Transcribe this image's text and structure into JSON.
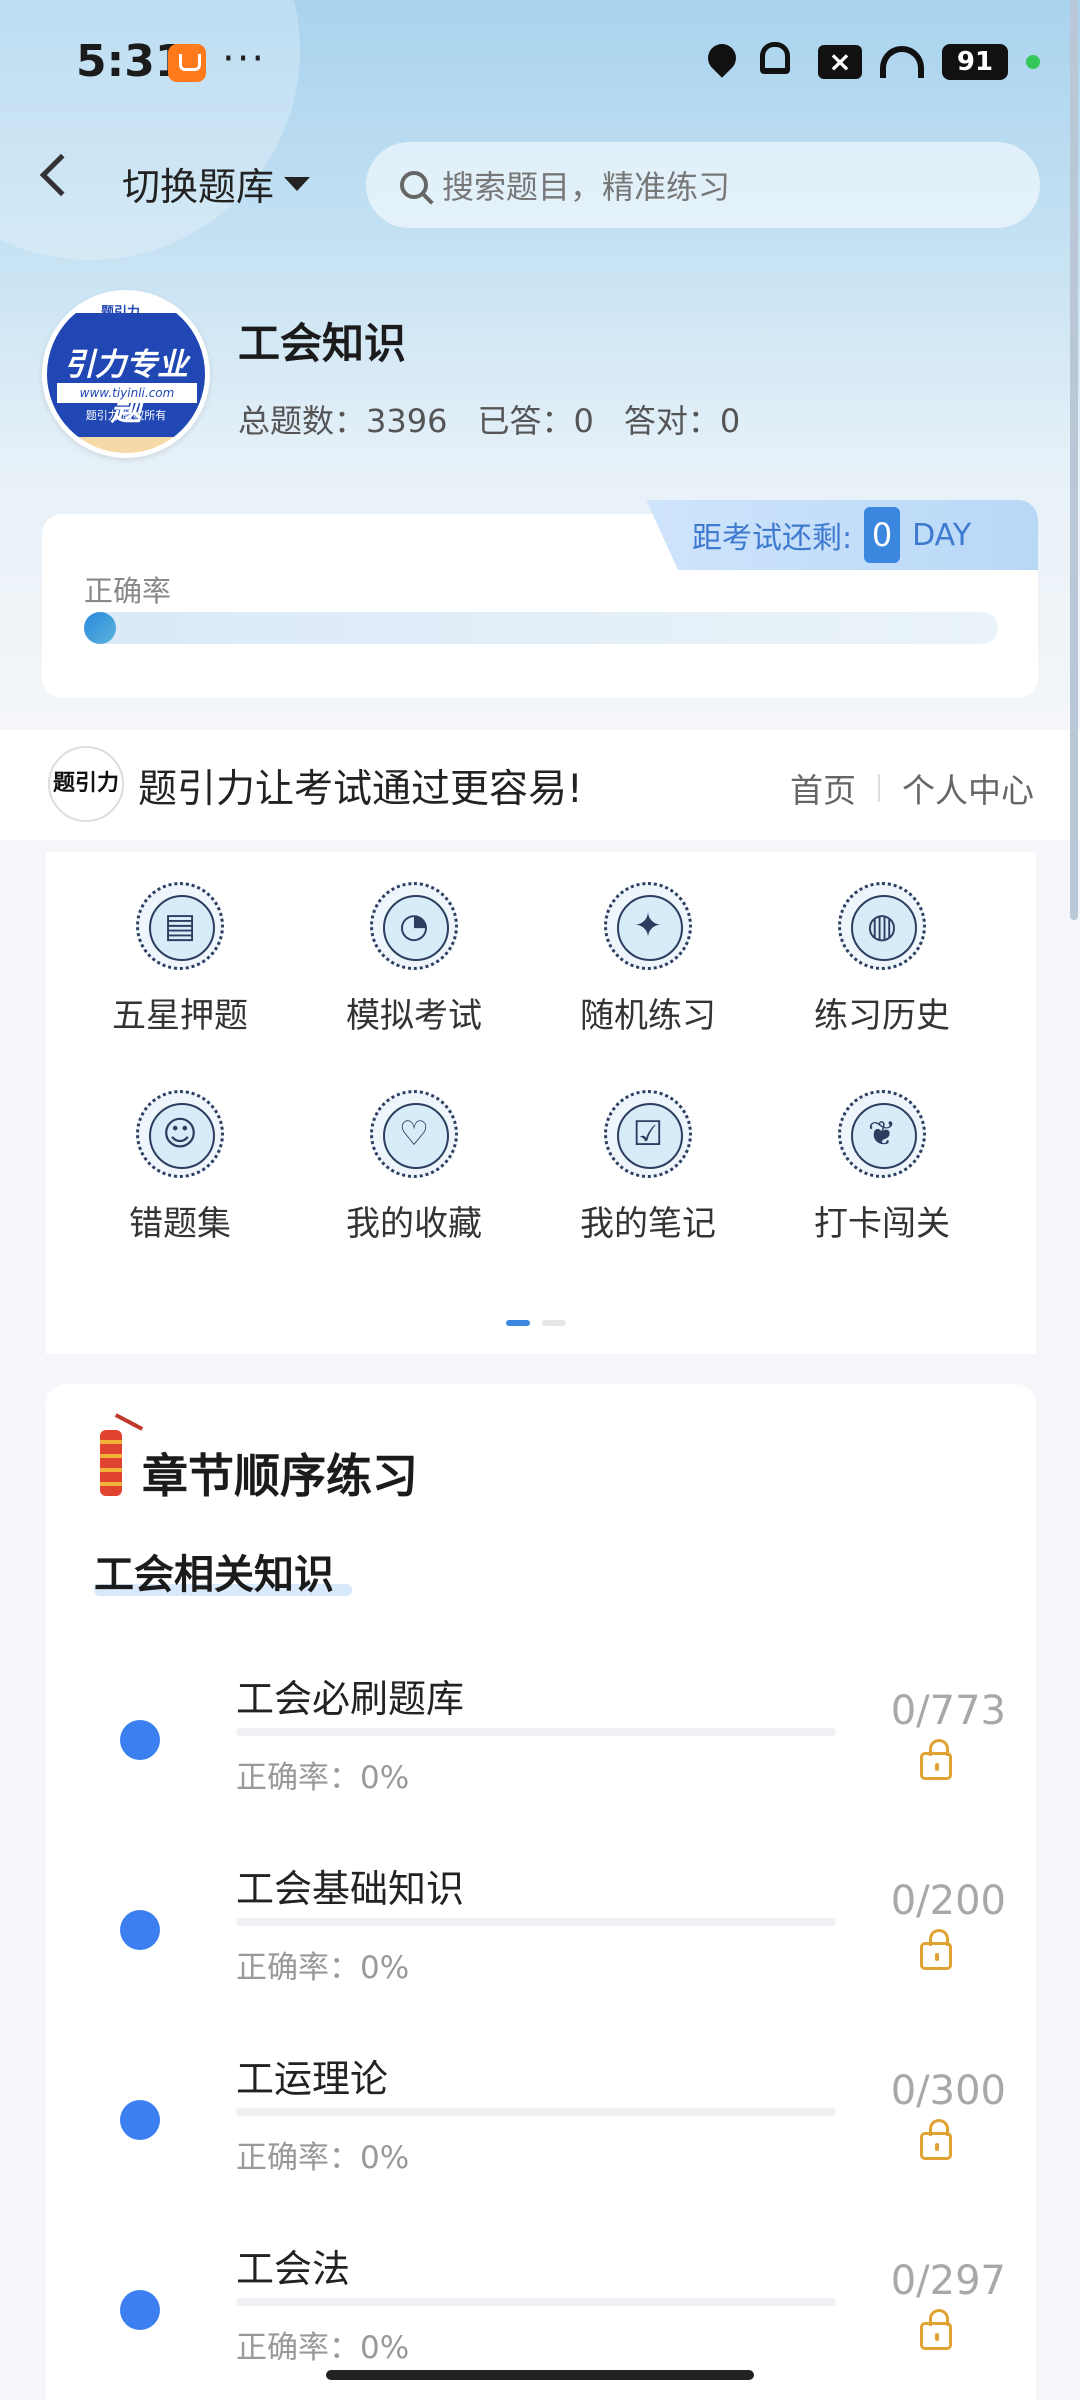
{
  "status_bar": {
    "time": "5:31",
    "dots": "···",
    "battery": "91",
    "icons": [
      "location-icon",
      "bell-muted-icon",
      "close-box-icon",
      "wifi-icon",
      "battery-icon"
    ]
  },
  "header": {
    "switch_label": "切换题库",
    "search_placeholder": "搜索题目，精准练习"
  },
  "bank": {
    "logo_top": "题引力",
    "logo_main": "引力专业题",
    "logo_url": "www.tiyinli.com",
    "logo_copy": "题引力 版权所有",
    "title": "工会知识",
    "total_label": "总题数：",
    "total": "3396",
    "answered_label": "已答：",
    "answered": "0",
    "correct_label": "答对：",
    "correct": "0"
  },
  "accuracy": {
    "countdown_label": "距考试还剩:",
    "countdown_value": "0",
    "countdown_unit": "DAY",
    "label": "正确率",
    "value_fraction": 0
  },
  "banner": {
    "logo_text": "题引力",
    "slogan": "题引力让考试通过更容易!",
    "link_home": "首页",
    "link_profile": "个人中心"
  },
  "menu": {
    "items": [
      {
        "label": "五星押题",
        "icon": "id-card-icon",
        "glyph": "▤"
      },
      {
        "label": "模拟考试",
        "icon": "gauge-icon",
        "glyph": "◔"
      },
      {
        "label": "随机练习",
        "icon": "network-icon",
        "glyph": "✦"
      },
      {
        "label": "练习历史",
        "icon": "globe-icon",
        "glyph": "◍"
      },
      {
        "label": "错题集",
        "icon": "head-icon",
        "glyph": "☺"
      },
      {
        "label": "我的收藏",
        "icon": "heart-icon",
        "glyph": "♡"
      },
      {
        "label": "我的笔记",
        "icon": "check-note-icon",
        "glyph": "☑"
      },
      {
        "label": "打卡闯关",
        "icon": "leaf-icon",
        "glyph": "❦"
      }
    ],
    "page_index": 0,
    "page_count": 2
  },
  "chapter": {
    "title": "章节顺序练习",
    "section": "工会相关知识",
    "rows": [
      {
        "name": "工会必刷题库",
        "accuracy": "正确率：0%",
        "count": "0/773",
        "progress": 0
      },
      {
        "name": "工会基础知识",
        "accuracy": "正确率：0%",
        "count": "0/200",
        "progress": 0
      },
      {
        "name": "工运理论",
        "accuracy": "正确率：0%",
        "count": "0/300",
        "progress": 0
      },
      {
        "name": "工会法",
        "accuracy": "正确率：0%",
        "count": "0/297",
        "progress": 0
      }
    ]
  },
  "colors": {
    "accent": "#3b87e0",
    "dot": "#3b7ff0",
    "lock": "#e0a232"
  }
}
